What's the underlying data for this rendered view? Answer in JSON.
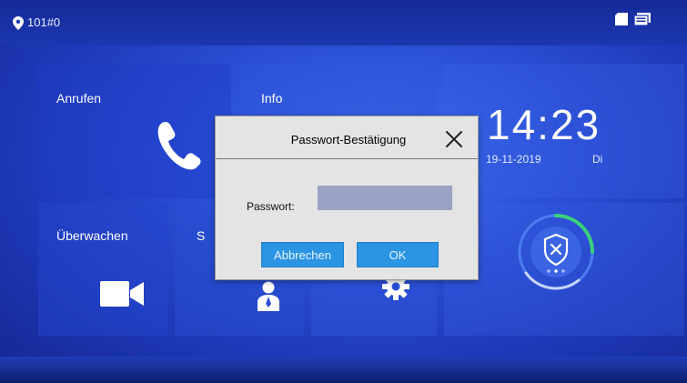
{
  "status_bar": {
    "location": "101#0",
    "icons": [
      "location-pin-icon",
      "sd-card-icon",
      "screen-icon"
    ]
  },
  "tiles": {
    "call": {
      "label": "Anrufen",
      "icon": "phone-icon"
    },
    "info": {
      "label": "Info"
    },
    "monitor": {
      "label": "Überwachen",
      "icon": "camera-icon"
    },
    "s": {
      "label": "S",
      "icon": "user-icon"
    },
    "settings": {
      "icon": "gear-icon"
    },
    "security": {
      "icon": "shield-icon"
    }
  },
  "clock": {
    "time": "14:23",
    "date": "19-11-2019",
    "day": "Di"
  },
  "dialog": {
    "title": "Passwort-Bestätigung",
    "password_label": "Passwort:",
    "password_value": "",
    "cancel_label": "Abbrechen",
    "ok_label": "OK"
  },
  "colors": {
    "background": "#2a4fd6",
    "button": "#2b95e3",
    "dialog": "#e4e4e4",
    "input": "#9aa3c4",
    "ring_green": "#3ad17a"
  }
}
